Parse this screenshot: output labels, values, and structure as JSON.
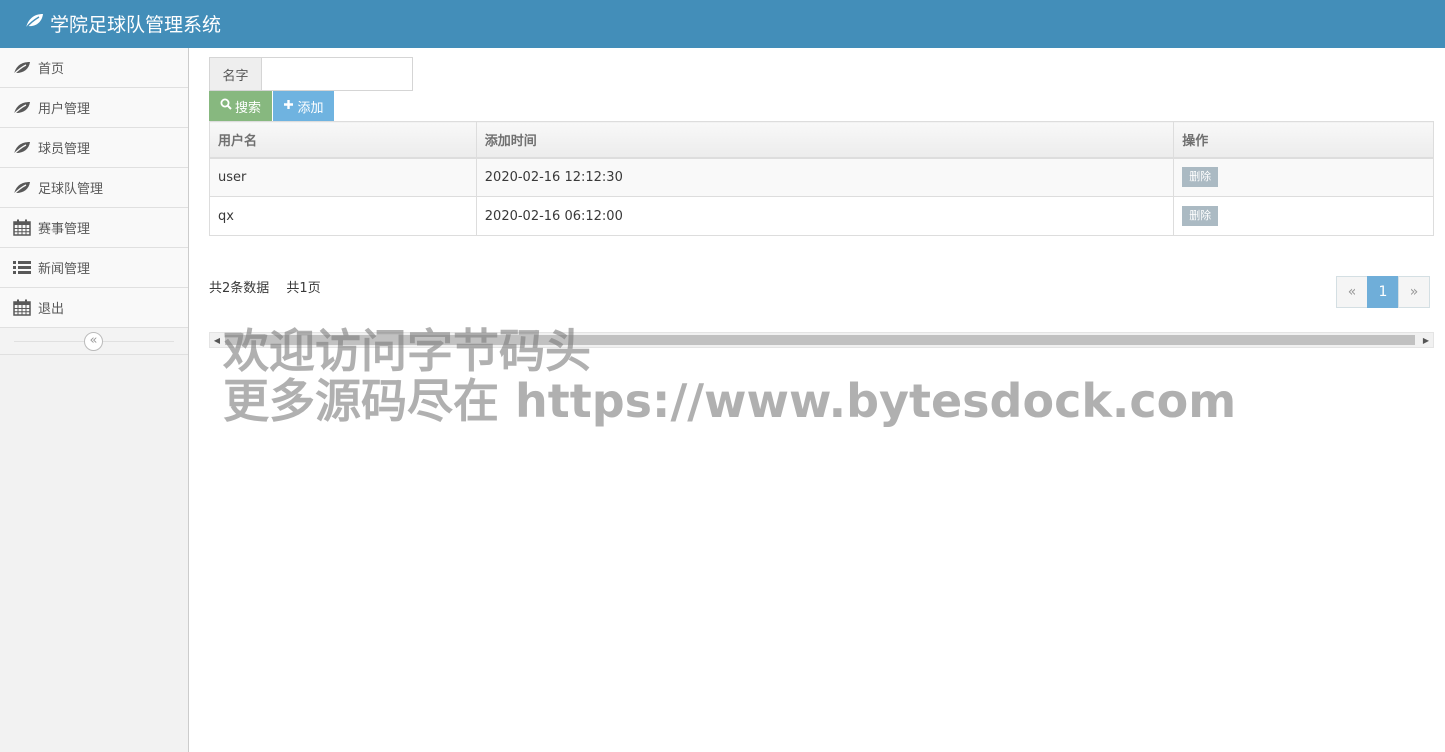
{
  "app": {
    "title": "学院足球队管理系统",
    "logo_icon": "leaf-icon"
  },
  "sidebar": {
    "items": [
      {
        "label": "首页",
        "icon": "leaf-icon"
      },
      {
        "label": "用户管理",
        "icon": "leaf-icon"
      },
      {
        "label": "球员管理",
        "icon": "leaf-icon"
      },
      {
        "label": "足球队管理",
        "icon": "leaf-icon"
      },
      {
        "label": "赛事管理",
        "icon": "calendar-icon"
      },
      {
        "label": "新闻管理",
        "icon": "list-icon"
      },
      {
        "label": "退出",
        "icon": "calendar-icon"
      }
    ],
    "collapse_glyph": "«"
  },
  "search": {
    "addon_label": "名字",
    "input_value": "",
    "search_button": "搜索",
    "add_button": "添加"
  },
  "table": {
    "columns": [
      "用户名",
      "添加时间",
      "操作"
    ],
    "rows": [
      {
        "username": "user",
        "added": "2020-02-16 12:12:30",
        "action": "删除"
      },
      {
        "username": "qx",
        "added": "2020-02-16 06:12:00",
        "action": "删除"
      }
    ]
  },
  "footer": {
    "total_records": "共2条数据",
    "total_pages": "共1页"
  },
  "pagination": {
    "prev": "«",
    "current": "1",
    "next": "»"
  },
  "watermark": {
    "line1": "欢迎访问字节码头",
    "line2": "更多源码尽在 https://www.bytesdock.com"
  },
  "colors": {
    "header": "#438eb9",
    "search_button": "#87b87f",
    "add_button": "#6fb3e0",
    "delete_button": "#abbac3",
    "page_active": "#6faed9"
  }
}
